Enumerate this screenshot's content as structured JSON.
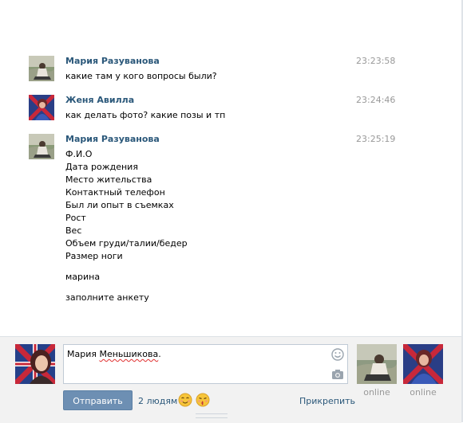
{
  "messages": [
    {
      "author": "Мария Разуванова",
      "time": "23:23:58",
      "avatar": "photo-maria",
      "lines": [
        "какие там у кого вопросы были?"
      ]
    },
    {
      "author": "Женя Авилла",
      "time": "23:24:46",
      "avatar": "photo-zhenya",
      "lines": [
        "как делать фото? какие позы и тп"
      ]
    },
    {
      "author": "Мария Разуванова",
      "time": "23:25:19",
      "avatar": "photo-maria",
      "lines": [
        "Ф.И.О",
        "Дата рождения",
        "Место жительства",
        "Контактный телефон",
        "Был ли опыт в съемках",
        "Рост",
        "Вес",
        "Объем груди/талии/бедер",
        "Размер ноги"
      ],
      "extra": [
        "марина",
        "заполните анкету"
      ]
    }
  ],
  "compose": {
    "text_first": "Мария ",
    "text_misspelled": "Меньшикова",
    "text_end": ".",
    "send_label": "Отправить",
    "recipients_label": "2 людям",
    "attach_label": "Прикрепить",
    "icons": [
      "smile-icon",
      "camera-icon",
      "emoji-smile-icon",
      "emoji-kiss-icon"
    ]
  },
  "participants": [
    {
      "name": "photo-maria",
      "status": "online"
    },
    {
      "name": "photo-zhenya",
      "status": "online"
    }
  ],
  "colors": {
    "link": "#2b587a",
    "button": "#6d8fb3",
    "time": "#999999",
    "compose_bg": "#f2f2f2"
  }
}
